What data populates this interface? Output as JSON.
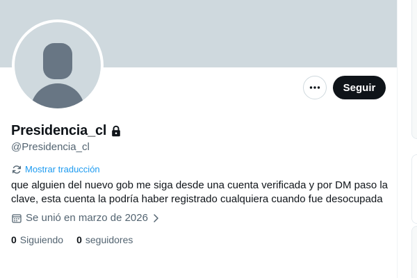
{
  "profile": {
    "display_name": "Presidencia_cl",
    "handle": "@Presidencia_cl",
    "protected": true,
    "translate_label": "Mostrar traducción",
    "bio": "que alguien del nuevo gob me siga desde una cuenta verificada y por DM paso la clave, esta cuenta la podría haber registrado cualquiera cuando fue desocupada",
    "joined": "Se unió en marzo de 2026",
    "following_count": "0",
    "following_label": "Siguiendo",
    "followers_count": "0",
    "followers_label": "seguidores"
  },
  "actions": {
    "more_icon": "more-horizontal-icon",
    "follow_label": "Seguir"
  },
  "icons": {
    "lock": "lock-icon",
    "translate": "translate-icon",
    "calendar": "calendar-icon",
    "chevron": "chevron-right-icon"
  },
  "colors": {
    "accent": "#1d9bf0",
    "banner": "#cfd9de",
    "text_primary": "#0f1419",
    "text_secondary": "#536471",
    "follow_button_bg": "#0f1419"
  }
}
